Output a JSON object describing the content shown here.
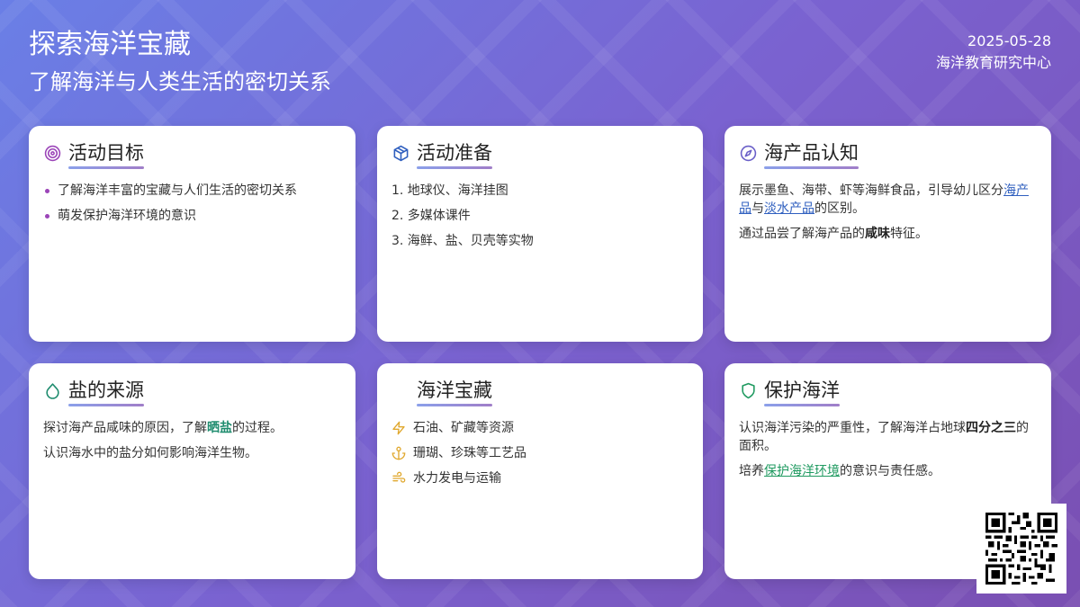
{
  "header": {
    "title": "探索海洋宝藏",
    "subtitle": "了解海洋与人类生活的密切关系",
    "date": "2025-05-28",
    "org": "海洋教育研究中心"
  },
  "colors": {
    "accent_purple": "#9b45b8",
    "accent_blue": "#2f5fbf",
    "accent_teal": "#1e8c6e",
    "accent_gold": "#e0a82e",
    "accent_green": "#1f9a60"
  },
  "cards": {
    "goal": {
      "icon": "target-icon",
      "title": "活动目标",
      "items": [
        "了解海洋丰富的宝藏与人们生活的密切关系",
        "萌发保护海洋环境的意识"
      ]
    },
    "prep": {
      "icon": "box-icon",
      "title": "活动准备",
      "items": [
        "1. 地球仪、海洋挂图",
        "2. 多媒体课件",
        "3. 海鲜、盐、贝壳等实物"
      ]
    },
    "seafood": {
      "icon": "compass-icon",
      "title": "海产品认知",
      "p1_a": "展示墨鱼、海带、虾等海鲜食品，引导幼儿区分",
      "p1_link1": "海产品",
      "p1_b": "与",
      "p1_link2": "淡水产品",
      "p1_c": "的区别。",
      "p2_a": "通过品尝了解海产品的",
      "p2_bold": "咸味",
      "p2_b": "特征。"
    },
    "salt": {
      "icon": "droplet-icon",
      "title": "盐的来源",
      "p1_a": "探讨海产品咸味的原因，了解",
      "p1_hl": "晒盐",
      "p1_b": "的过程。",
      "p2": "认识海水中的盐分如何影响海洋生物。"
    },
    "treasure": {
      "title": "海洋宝藏",
      "rows": [
        {
          "icon": "lightning-icon",
          "text": "石油、矿藏等资源"
        },
        {
          "icon": "anchor-icon",
          "text": "珊瑚、珍珠等工艺品"
        },
        {
          "icon": "wind-icon",
          "text": "水力发电与运输"
        }
      ]
    },
    "protect": {
      "icon": "shield-icon",
      "title": "保护海洋",
      "p1_a": "认识海洋污染的严重性，了解海洋占地球",
      "p1_bold": "四分之三",
      "p1_b": "的面积。",
      "p2_a": "培养",
      "p2_link": "保护海洋环境",
      "p2_b": "的意识与责任感。"
    }
  },
  "qr": {
    "icon": "qr-code-icon"
  }
}
